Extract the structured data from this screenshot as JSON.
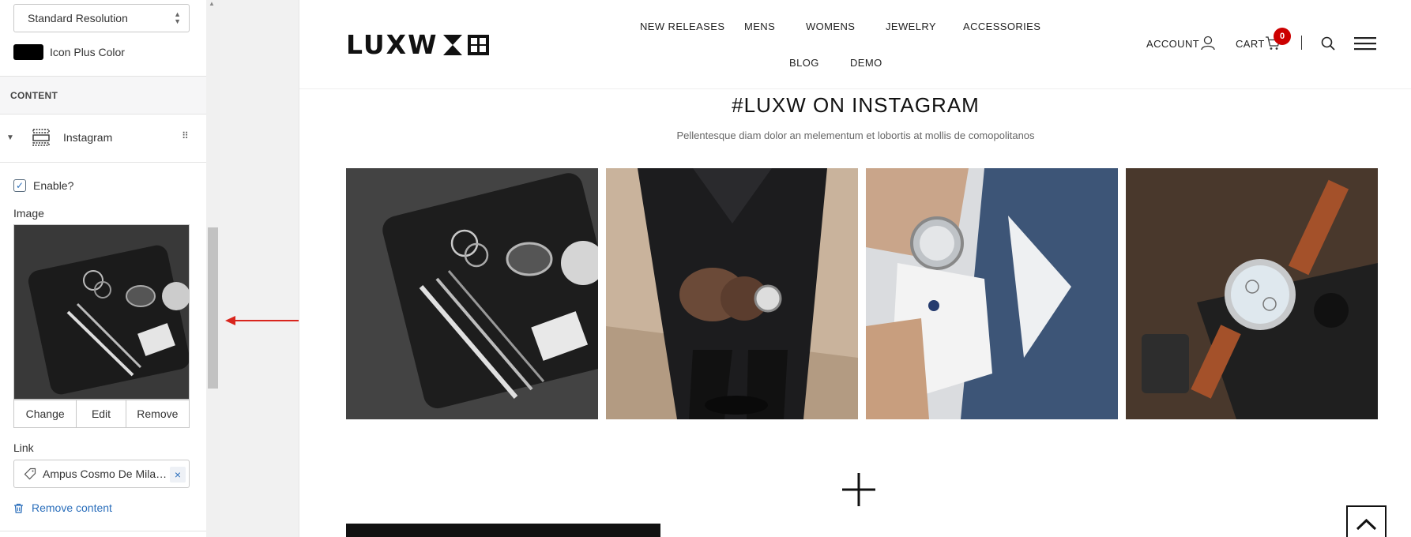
{
  "editor": {
    "resolution_select": "Standard Resolution",
    "color_setting": {
      "label": "Icon Plus Color",
      "value": "#000000"
    },
    "section_title": "CONTENT",
    "block": {
      "label": "Instagram",
      "expanded": true
    },
    "enable": {
      "label": "Enable?",
      "checked": true
    },
    "image_label": "Image",
    "image_actions": {
      "change": "Change",
      "edit": "Edit",
      "remove": "Remove"
    },
    "link_label": "Link",
    "link_value": "Ampus Cosmo De Milan...",
    "remove_content": "Remove content"
  },
  "store": {
    "logo": "LUXW",
    "nav": {
      "row1": [
        "NEW RELEASES",
        "MENS",
        "WOMENS",
        "JEWELRY",
        "ACCESSORIES"
      ],
      "row2": [
        "BLOG",
        "DEMO"
      ]
    },
    "account": "ACCOUNT",
    "cart": "CART",
    "cart_count": "0",
    "instagram": {
      "title": "#LUXW ON INSTAGRAM",
      "subtitle": "Pellentesque diam dolor an melementum et lobortis at mollis de comopolitanos"
    }
  },
  "colors": {
    "accent": "#2a6ebb",
    "badge": "#cc0000",
    "annotation_arrow": "#d9251d"
  }
}
